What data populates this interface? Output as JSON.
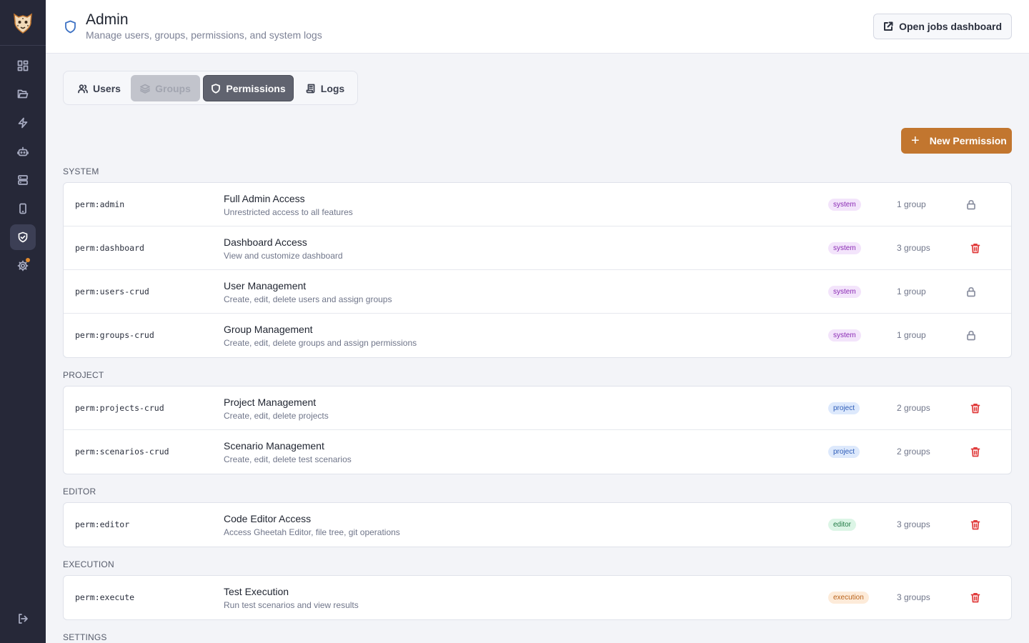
{
  "header": {
    "title": "Admin",
    "subtitle": "Manage users, groups, permissions, and system logs",
    "jobs_button": "Open jobs dashboard"
  },
  "sidebar": {
    "items": [
      {
        "icon": "dashboard-icon"
      },
      {
        "icon": "folder-icon"
      },
      {
        "icon": "lightning-icon"
      },
      {
        "icon": "bot-icon"
      },
      {
        "icon": "server-icon"
      },
      {
        "icon": "device-icon"
      },
      {
        "icon": "shield-check-icon",
        "active": true
      },
      {
        "icon": "gear-icon",
        "notification": true
      }
    ],
    "logout_icon": "logout-icon"
  },
  "tabs": {
    "users": "Users",
    "groups": "Groups",
    "permissions": "Permissions",
    "logs": "Logs",
    "active": "Permissions"
  },
  "new_button": "New Permission",
  "sections": {
    "system": {
      "label": "SYSTEM",
      "rows": [
        {
          "key": "perm:admin",
          "name": "Full Admin Access",
          "desc": "Unrestricted access to all features",
          "badge": "system",
          "count": "1 group",
          "action": "lock"
        },
        {
          "key": "perm:dashboard",
          "name": "Dashboard Access",
          "desc": "View and customize dashboard",
          "badge": "system",
          "count": "3 groups",
          "action": "delete"
        },
        {
          "key": "perm:users-crud",
          "name": "User Management",
          "desc": "Create, edit, delete users and assign groups",
          "badge": "system",
          "count": "1 group",
          "action": "lock"
        },
        {
          "key": "perm:groups-crud",
          "name": "Group Management",
          "desc": "Create, edit, delete groups and assign permissions",
          "badge": "system",
          "count": "1 group",
          "action": "lock"
        }
      ]
    },
    "project": {
      "label": "PROJECT",
      "rows": [
        {
          "key": "perm:projects-crud",
          "name": "Project Management",
          "desc": "Create, edit, delete projects",
          "badge": "project",
          "count": "2 groups",
          "action": "delete"
        },
        {
          "key": "perm:scenarios-crud",
          "name": "Scenario Management",
          "desc": "Create, edit, delete test scenarios",
          "badge": "project",
          "count": "2 groups",
          "action": "delete"
        }
      ]
    },
    "editor": {
      "label": "EDITOR",
      "rows": [
        {
          "key": "perm:editor",
          "name": "Code Editor Access",
          "desc": "Access Gheetah Editor, file tree, git operations",
          "badge": "editor",
          "count": "3 groups",
          "action": "delete"
        }
      ]
    },
    "execution": {
      "label": "EXECUTION",
      "rows": [
        {
          "key": "perm:execute",
          "name": "Test Execution",
          "desc": "Run test scenarios and view results",
          "badge": "execution",
          "count": "3 groups",
          "action": "delete"
        }
      ]
    },
    "settings": {
      "label": "SETTINGS"
    }
  },
  "colors": {
    "sidebar": "#262838",
    "accent": "#c2762f",
    "danger": "#e03a3a",
    "header_icon": "#3f73c4"
  }
}
